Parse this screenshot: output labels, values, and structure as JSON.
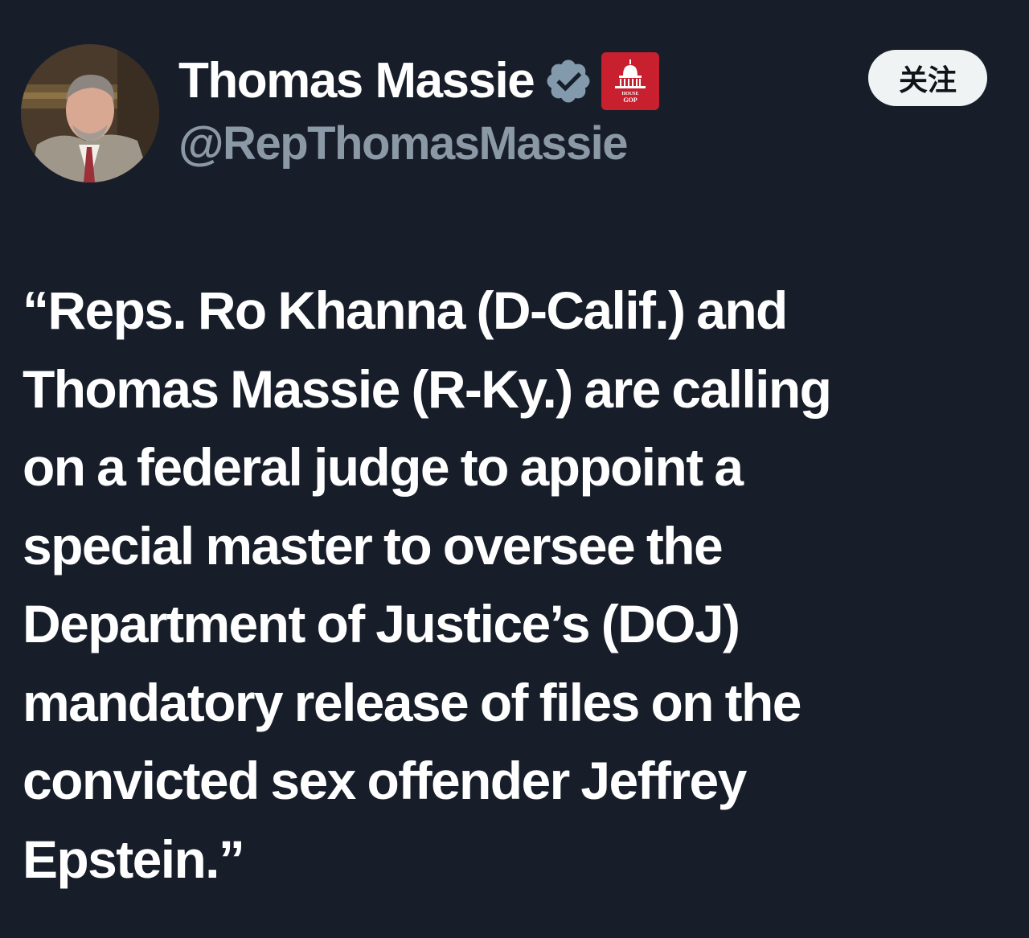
{
  "author": {
    "display_name": "Thomas Massie",
    "handle": "@RepThomasMassie",
    "verified_icon": "verified-badge-icon",
    "affiliation_badge": {
      "icon": "house-gop-logo",
      "text_top": "HOUSE",
      "text_bottom": "GOP"
    }
  },
  "follow_button": {
    "label": "关注"
  },
  "tweet": {
    "lines": [
      "“Reps. Ro Khanna (D-Calif.) and",
      "Thomas Massie (R-Ky.) are calling",
      "on a federal judge to appoint a",
      "special master to oversee the",
      "Department of Justice’s (DOJ)",
      "mandatory release of files on the",
      "convicted sex offender Jeffrey",
      "Epstein.”"
    ]
  },
  "colors": {
    "background": "#171e29",
    "text_primary": "#ffffff",
    "text_secondary": "#8b98a5",
    "verified_badge": "#829aab",
    "affiliation_red": "#c8202f",
    "follow_bg": "#eff3f4"
  }
}
